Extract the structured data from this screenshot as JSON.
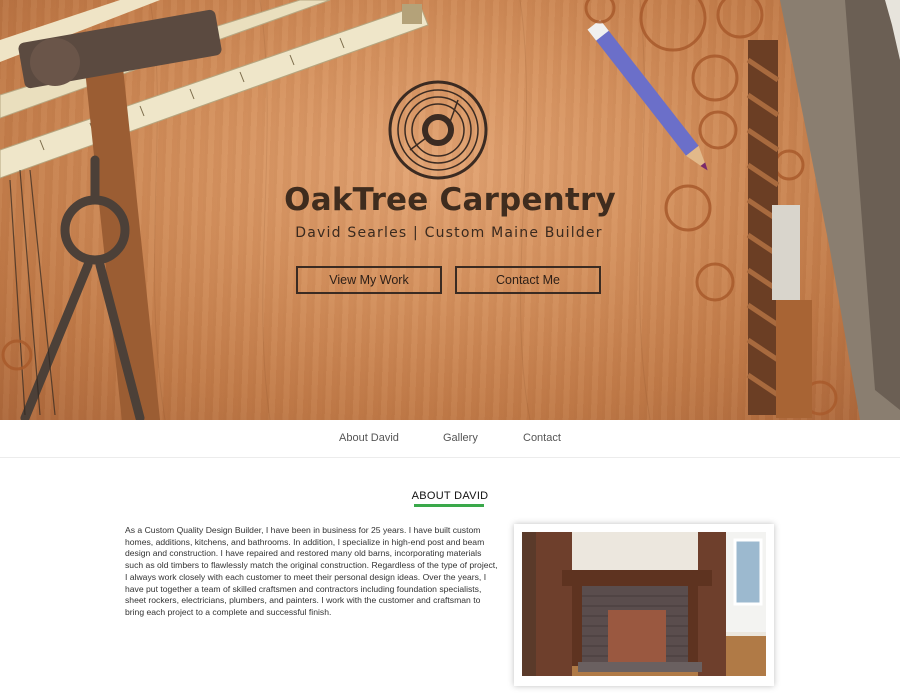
{
  "hero": {
    "brand_name": "OakTree Carpentry",
    "tagline": "David Searles | Custom Maine Builder",
    "view_work_label": "View My Work",
    "contact_label": "Contact Me"
  },
  "nav": {
    "items": [
      {
        "label": "About David"
      },
      {
        "label": "Gallery"
      },
      {
        "label": "Contact"
      }
    ]
  },
  "about": {
    "title": "ABOUT DAVID",
    "body": "As a Custom Quality Design Builder, I have been in business for 25 years. I have built custom homes, additions, kitchens, and bathrooms. In addition, I specialize in high-end post and beam design and construction. I have repaired and restored many old barns, incorporating materials such as old timbers to flawlessly match the original construction. Regardless of the type of project, I always work closely with each customer to meet their personal design ideas. Over the years, I have put together a team of skilled craftsmen and contractors including foundation specialists, sheet rockers, electricians, plumbers, and painters. I work with the customer and craftsman to bring each project to a complete and successful finish."
  },
  "colors": {
    "accent_underline": "#3aa84a",
    "brand_text": "#3f2c1e",
    "wood_background": "#d4915e"
  },
  "icons": {
    "logo": "tree-ring-logo"
  }
}
